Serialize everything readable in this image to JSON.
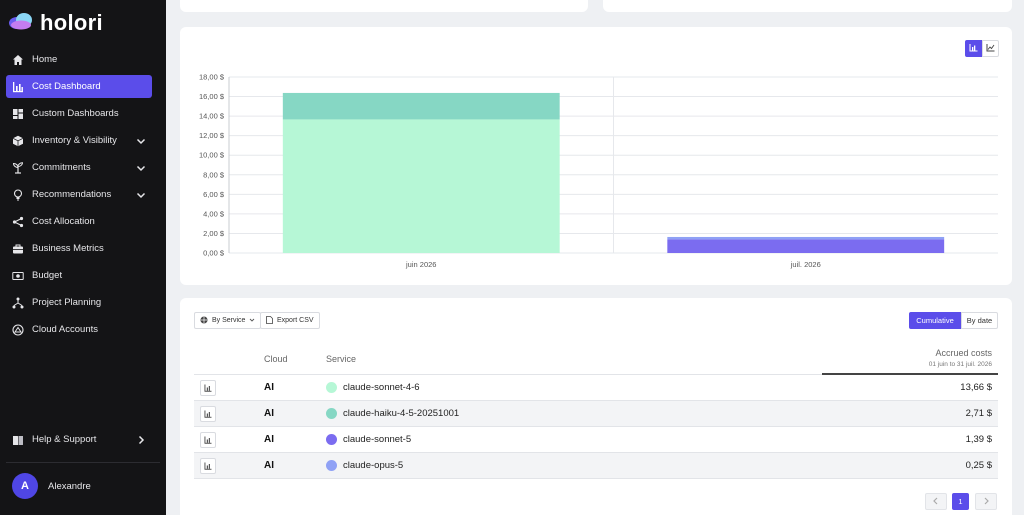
{
  "app": {
    "name": "holori"
  },
  "sidebar": {
    "items": [
      {
        "label": "Home",
        "icon": "home-icon",
        "active": false,
        "expandable": false
      },
      {
        "label": "Cost Dashboard",
        "icon": "bar-chart-icon",
        "active": true,
        "expandable": false
      },
      {
        "label": "Custom Dashboards",
        "icon": "dashboard-icon",
        "active": false,
        "expandable": false
      },
      {
        "label": "Inventory & Visibility",
        "icon": "cube-icon",
        "active": false,
        "expandable": true
      },
      {
        "label": "Commitments",
        "icon": "sprout-icon",
        "active": false,
        "expandable": true
      },
      {
        "label": "Recommendations",
        "icon": "lightbulb-icon",
        "active": false,
        "expandable": true
      },
      {
        "label": "Cost Allocation",
        "icon": "share-icon",
        "active": false,
        "expandable": false
      },
      {
        "label": "Business Metrics",
        "icon": "briefcase-icon",
        "active": false,
        "expandable": false
      },
      {
        "label": "Budget",
        "icon": "money-icon",
        "active": false,
        "expandable": false
      },
      {
        "label": "Project Planning",
        "icon": "hierarchy-icon",
        "active": false,
        "expandable": false
      },
      {
        "label": "Cloud Accounts",
        "icon": "cloud-account-icon",
        "active": false,
        "expandable": false
      }
    ],
    "help_label": "Help & Support",
    "user": {
      "initial": "A",
      "name": "Alexandre"
    }
  },
  "chart_data": {
    "type": "bar",
    "stacked": true,
    "categories": [
      "juin 2026",
      "juil. 2026"
    ],
    "series": [
      {
        "name": "claude-sonnet-4-6",
        "color": "#b6f7d6",
        "values": [
          13.66,
          0
        ]
      },
      {
        "name": "claude-haiku-4-5-20251001",
        "color": "#86d7c4",
        "values": [
          2.71,
          0
        ]
      },
      {
        "name": "claude-sonnet-5",
        "color": "#7b6cf0",
        "values": [
          0,
          1.39
        ]
      },
      {
        "name": "claude-opus-5",
        "color": "#8fa1f5",
        "values": [
          0,
          0.25
        ]
      }
    ],
    "ylim": [
      0,
      18
    ],
    "yticks": [
      "0,00 $",
      "2,00 $",
      "4,00 $",
      "6,00 $",
      "8,00 $",
      "10,00 $",
      "12,00 $",
      "14,00 $",
      "16,00 $",
      "18,00 $"
    ],
    "grid": true
  },
  "chart_toggle": {
    "bar_icon": "bar-chart-icon",
    "line_icon": "line-chart-icon",
    "selected": "bar"
  },
  "table": {
    "group_by_label": "By Service",
    "export_label": "Export CSV",
    "view_toggle": {
      "cumulative": "Cumulative",
      "by_date": "By date",
      "selected": "cumulative"
    },
    "columns": {
      "cloud": "Cloud",
      "service": "Service",
      "accrued": "Accrued costs",
      "period": "01 juin to 31 juil. 2026"
    },
    "rows": [
      {
        "cloud": "AI",
        "service": "claude-sonnet-4-6",
        "color": "#b6f7d6",
        "cost": "13,66 $"
      },
      {
        "cloud": "AI",
        "service": "claude-haiku-4-5-20251001",
        "color": "#86d7c4",
        "cost": "2,71 $"
      },
      {
        "cloud": "AI",
        "service": "claude-sonnet-5",
        "color": "#7b6cf0",
        "cost": "1,39 $"
      },
      {
        "cloud": "AI",
        "service": "claude-opus-5",
        "color": "#8fa1f5",
        "cost": "0,25 $"
      }
    ],
    "pagination": {
      "current_page": "1"
    }
  }
}
